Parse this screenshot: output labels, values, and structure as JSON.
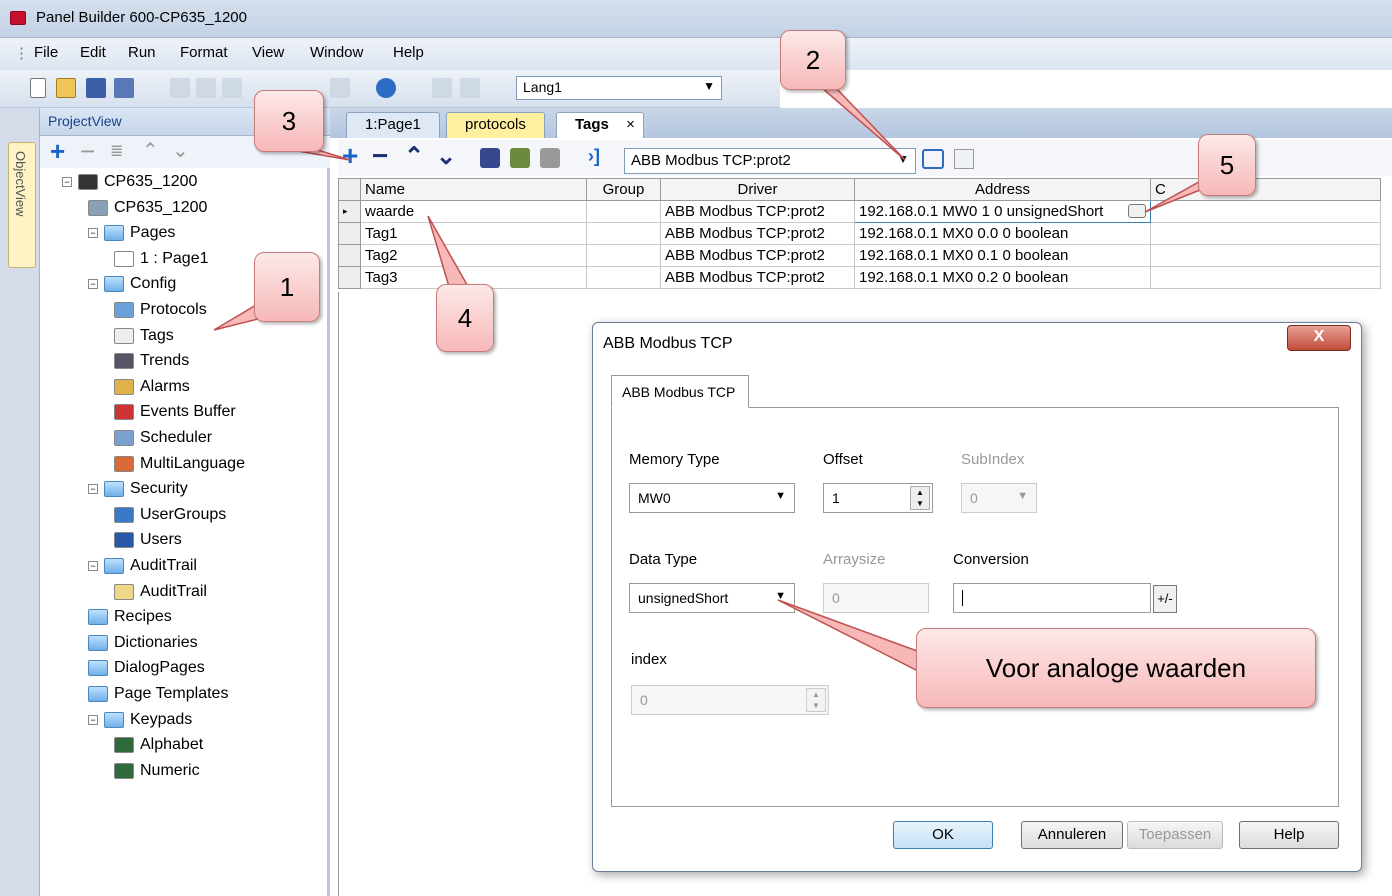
{
  "window": {
    "title": "Panel Builder 600-CP635_1200"
  },
  "menu": [
    "File",
    "Edit",
    "Run",
    "Format",
    "View",
    "Window",
    "Help"
  ],
  "toolbar": {
    "language": "Lang1"
  },
  "project_view": {
    "title": "ProjectView",
    "object_view_label": "ObjectView",
    "tree": [
      {
        "label": "CP635_1200",
        "level": 0,
        "icon": "monitor-icon",
        "expanded": true
      },
      {
        "label": "CP635_1200",
        "level": 1,
        "icon": "gear-icon"
      },
      {
        "label": "Pages",
        "level": 1,
        "icon": "folder-icon",
        "expanded": true
      },
      {
        "label": "1 : Page1",
        "level": 2,
        "icon": "page-icon"
      },
      {
        "label": "Config",
        "level": 1,
        "icon": "folder-icon",
        "expanded": true
      },
      {
        "label": "Protocols",
        "level": 2,
        "icon": "protocol-icon"
      },
      {
        "label": "Tags",
        "level": 2,
        "icon": "tags-icon"
      },
      {
        "label": "Trends",
        "level": 2,
        "icon": "trends-icon"
      },
      {
        "label": "Alarms",
        "level": 2,
        "icon": "alarm-icon"
      },
      {
        "label": "Events Buffer",
        "level": 2,
        "icon": "events-icon"
      },
      {
        "label": "Scheduler",
        "level": 2,
        "icon": "scheduler-icon"
      },
      {
        "label": "MultiLanguage",
        "level": 2,
        "icon": "language-icon"
      },
      {
        "label": "Security",
        "level": 1,
        "icon": "folder-icon",
        "expanded": true
      },
      {
        "label": "UserGroups",
        "level": 2,
        "icon": "usergroups-icon"
      },
      {
        "label": "Users",
        "level": 2,
        "icon": "user-icon"
      },
      {
        "label": "AuditTrail",
        "level": 1,
        "icon": "folder-icon",
        "expanded": true
      },
      {
        "label": "AuditTrail",
        "level": 2,
        "icon": "audit-icon"
      },
      {
        "label": "Recipes",
        "level": 1,
        "icon": "folder-icon"
      },
      {
        "label": "Dictionaries",
        "level": 1,
        "icon": "folder-icon"
      },
      {
        "label": "DialogPages",
        "level": 1,
        "icon": "folder-icon"
      },
      {
        "label": "Page Templates",
        "level": 1,
        "icon": "folder-icon"
      },
      {
        "label": "Keypads",
        "level": 1,
        "icon": "folder-icon",
        "expanded": true
      },
      {
        "label": "Alphabet",
        "level": 2,
        "icon": "keypad-icon"
      },
      {
        "label": "Numeric",
        "level": 2,
        "icon": "keypad-icon"
      }
    ]
  },
  "tabs": [
    {
      "label": "1:Page1",
      "color": "#dfe8f5"
    },
    {
      "label": "protocols",
      "color": "#fff0a0"
    },
    {
      "label": "Tags",
      "color": "#ffffff",
      "active": true
    }
  ],
  "tags_toolbar": {
    "protocol": "ABB Modbus TCP:prot2"
  },
  "grid": {
    "columns": [
      "Name",
      "Group",
      "Driver",
      "Address"
    ],
    "rows": [
      {
        "name": "waarde",
        "group": "",
        "driver": "ABB Modbus TCP:prot2",
        "address": "192.168.0.1 MW0 1 0 unsignedShort"
      },
      {
        "name": "Tag1",
        "group": "",
        "driver": "ABB Modbus TCP:prot2",
        "address": "192.168.0.1 MX0 0.0 0 boolean"
      },
      {
        "name": "Tag2",
        "group": "",
        "driver": "ABB Modbus TCP:prot2",
        "address": "192.168.0.1 MX0 0.1 0 boolean"
      },
      {
        "name": "Tag3",
        "group": "",
        "driver": "ABB Modbus TCP:prot2",
        "address": "192.168.0.1 MX0 0.2 0 boolean"
      }
    ]
  },
  "dialog": {
    "title": "ABB Modbus TCP",
    "tab": "ABB Modbus TCP",
    "close": "X",
    "memory_type": {
      "label": "Memory Type",
      "value": "MW0"
    },
    "offset": {
      "label": "Offset",
      "value": "1"
    },
    "subindex": {
      "label": "SubIndex",
      "value": "0"
    },
    "data_type": {
      "label": "Data Type",
      "value": "unsignedShort"
    },
    "arraysize": {
      "label": "Arraysize",
      "value": "0"
    },
    "conversion": {
      "label": "Conversion",
      "value": "",
      "button": "+/-"
    },
    "index": {
      "label": "index",
      "value": "0"
    },
    "buttons": {
      "ok": "OK",
      "cancel": "Annuleren",
      "apply": "Toepassen",
      "help": "Help"
    }
  },
  "callouts": {
    "c1": "1",
    "c2": "2",
    "c3": "3",
    "c4": "4",
    "c5": "5",
    "note": "Voor analoge waarden"
  },
  "colors": {
    "callout": "#f7b8b8",
    "accent": "#15428b"
  }
}
